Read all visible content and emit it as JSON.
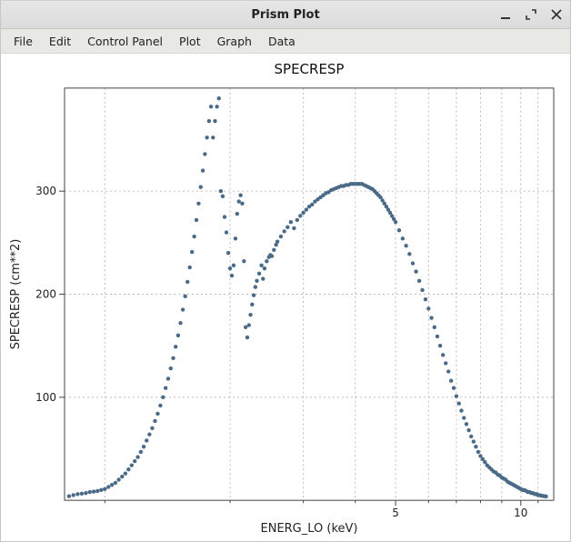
{
  "window": {
    "title": "Prism Plot"
  },
  "menu": {
    "items": [
      {
        "label": "File"
      },
      {
        "label": "Edit"
      },
      {
        "label": "Control Panel"
      },
      {
        "label": "Plot"
      },
      {
        "label": "Graph"
      },
      {
        "label": "Data"
      }
    ]
  },
  "chart_data": {
    "type": "scatter",
    "title": "SPECRESP",
    "xlabel": "ENERG_LO (keV)",
    "ylabel": "SPECRESP (cm**2)",
    "xscale": "log",
    "yscale": "linear",
    "xlim": [
      0.8,
      12
    ],
    "ylim": [
      0,
      400
    ],
    "xticks_major": [
      5,
      10
    ],
    "xticks_minor": [
      1,
      2,
      3,
      4,
      6,
      7,
      8,
      9,
      11
    ],
    "yticks_major": [
      100,
      200,
      300
    ],
    "color": "#4a6a88",
    "grid": true,
    "series": [
      {
        "name": "SPECRESP",
        "points": [
          [
            0.82,
            4
          ],
          [
            0.84,
            5
          ],
          [
            0.86,
            6
          ],
          [
            0.88,
            6.5
          ],
          [
            0.9,
            7
          ],
          [
            0.92,
            8
          ],
          [
            0.94,
            8.5
          ],
          [
            0.96,
            9
          ],
          [
            0.98,
            10
          ],
          [
            1.0,
            11
          ],
          [
            1.02,
            13
          ],
          [
            1.04,
            15
          ],
          [
            1.06,
            17
          ],
          [
            1.08,
            20
          ],
          [
            1.1,
            23
          ],
          [
            1.12,
            26
          ],
          [
            1.14,
            30
          ],
          [
            1.16,
            34
          ],
          [
            1.18,
            38
          ],
          [
            1.2,
            42
          ],
          [
            1.22,
            47
          ],
          [
            1.24,
            52
          ],
          [
            1.26,
            58
          ],
          [
            1.28,
            64
          ],
          [
            1.3,
            70
          ],
          [
            1.32,
            77
          ],
          [
            1.34,
            84
          ],
          [
            1.36,
            92
          ],
          [
            1.38,
            100
          ],
          [
            1.4,
            109
          ],
          [
            1.42,
            118
          ],
          [
            1.44,
            128
          ],
          [
            1.46,
            138
          ],
          [
            1.48,
            149
          ],
          [
            1.5,
            160
          ],
          [
            1.52,
            172
          ],
          [
            1.54,
            185
          ],
          [
            1.56,
            198
          ],
          [
            1.58,
            212
          ],
          [
            1.6,
            226
          ],
          [
            1.62,
            241
          ],
          [
            1.64,
            256
          ],
          [
            1.66,
            272
          ],
          [
            1.68,
            288
          ],
          [
            1.7,
            304
          ],
          [
            1.72,
            320
          ],
          [
            1.74,
            336
          ],
          [
            1.76,
            352
          ],
          [
            1.78,
            368
          ],
          [
            1.8,
            382
          ],
          [
            1.82,
            352
          ],
          [
            1.84,
            368
          ],
          [
            1.86,
            382
          ],
          [
            1.88,
            390
          ],
          [
            1.9,
            300
          ],
          [
            1.92,
            295
          ],
          [
            1.94,
            275
          ],
          [
            1.96,
            260
          ],
          [
            1.98,
            240
          ],
          [
            2.0,
            225
          ],
          [
            2.02,
            218
          ],
          [
            2.04,
            228
          ],
          [
            2.06,
            254
          ],
          [
            2.08,
            278
          ],
          [
            2.1,
            290
          ],
          [
            2.12,
            296
          ],
          [
            2.14,
            288
          ],
          [
            2.16,
            232
          ],
          [
            2.18,
            168
          ],
          [
            2.2,
            158
          ],
          [
            2.22,
            170
          ],
          [
            2.24,
            180
          ],
          [
            2.26,
            190
          ],
          [
            2.28,
            199
          ],
          [
            2.3,
            207
          ],
          [
            2.32,
            213
          ],
          [
            2.35,
            220
          ],
          [
            2.38,
            228
          ],
          [
            2.4,
            215
          ],
          [
            2.42,
            225
          ],
          [
            2.45,
            232
          ],
          [
            2.48,
            236
          ],
          [
            2.5,
            238
          ],
          [
            2.52,
            237
          ],
          [
            2.55,
            243
          ],
          [
            2.58,
            248
          ],
          [
            2.6,
            251
          ],
          [
            2.65,
            256
          ],
          [
            2.7,
            261
          ],
          [
            2.75,
            265
          ],
          [
            2.8,
            270
          ],
          [
            2.85,
            264
          ],
          [
            2.9,
            272
          ],
          [
            2.95,
            276
          ],
          [
            3.0,
            279
          ],
          [
            3.05,
            282
          ],
          [
            3.1,
            285
          ],
          [
            3.15,
            287
          ],
          [
            3.2,
            290
          ],
          [
            3.25,
            292
          ],
          [
            3.3,
            294
          ],
          [
            3.35,
            296
          ],
          [
            3.4,
            298
          ],
          [
            3.45,
            299
          ],
          [
            3.5,
            301
          ],
          [
            3.55,
            302
          ],
          [
            3.6,
            303
          ],
          [
            3.65,
            304
          ],
          [
            3.7,
            305
          ],
          [
            3.75,
            305
          ],
          [
            3.8,
            306
          ],
          [
            3.85,
            306
          ],
          [
            3.9,
            307
          ],
          [
            3.95,
            307
          ],
          [
            4.0,
            307
          ],
          [
            4.05,
            307
          ],
          [
            4.1,
            307
          ],
          [
            4.15,
            307
          ],
          [
            4.2,
            306
          ],
          [
            4.25,
            305
          ],
          [
            4.3,
            304
          ],
          [
            4.35,
            303
          ],
          [
            4.4,
            302
          ],
          [
            4.45,
            300
          ],
          [
            4.5,
            298
          ],
          [
            4.55,
            296
          ],
          [
            4.6,
            294
          ],
          [
            4.65,
            291
          ],
          [
            4.7,
            288
          ],
          [
            4.75,
            285
          ],
          [
            4.8,
            282
          ],
          [
            4.85,
            279
          ],
          [
            4.9,
            276
          ],
          [
            4.95,
            273
          ],
          [
            5.0,
            270
          ],
          [
            5.1,
            262
          ],
          [
            5.2,
            254
          ],
          [
            5.3,
            247
          ],
          [
            5.4,
            239
          ],
          [
            5.5,
            230
          ],
          [
            5.6,
            222
          ],
          [
            5.7,
            213
          ],
          [
            5.8,
            204
          ],
          [
            5.9,
            195
          ],
          [
            6.0,
            186
          ],
          [
            6.1,
            177
          ],
          [
            6.2,
            168
          ],
          [
            6.3,
            159
          ],
          [
            6.4,
            150
          ],
          [
            6.5,
            141
          ],
          [
            6.6,
            133
          ],
          [
            6.7,
            125
          ],
          [
            6.8,
            116
          ],
          [
            6.9,
            109
          ],
          [
            7.0,
            101
          ],
          [
            7.1,
            94
          ],
          [
            7.2,
            87
          ],
          [
            7.3,
            80
          ],
          [
            7.4,
            74
          ],
          [
            7.5,
            68
          ],
          [
            7.6,
            62
          ],
          [
            7.7,
            57
          ],
          [
            7.8,
            52
          ],
          [
            7.9,
            47
          ],
          [
            8.0,
            43
          ],
          [
            8.1,
            40
          ],
          [
            8.2,
            37
          ],
          [
            8.3,
            34
          ],
          [
            8.4,
            32
          ],
          [
            8.5,
            30
          ],
          [
            8.6,
            28
          ],
          [
            8.7,
            27
          ],
          [
            8.8,
            25
          ],
          [
            8.9,
            24
          ],
          [
            9.0,
            22
          ],
          [
            9.1,
            21
          ],
          [
            9.2,
            20
          ],
          [
            9.3,
            18
          ],
          [
            9.4,
            17
          ],
          [
            9.5,
            16
          ],
          [
            9.6,
            15
          ],
          [
            9.7,
            14
          ],
          [
            9.8,
            13
          ],
          [
            9.9,
            12
          ],
          [
            10.0,
            11
          ],
          [
            10.1,
            10
          ],
          [
            10.2,
            10
          ],
          [
            10.3,
            9
          ],
          [
            10.4,
            8
          ],
          [
            10.5,
            8
          ],
          [
            10.6,
            7
          ],
          [
            10.7,
            7
          ],
          [
            10.8,
            6
          ],
          [
            10.9,
            6
          ],
          [
            11.0,
            5
          ],
          [
            11.1,
            5
          ],
          [
            11.2,
            4.5
          ],
          [
            11.3,
            4.3
          ],
          [
            11.4,
            4
          ],
          [
            11.5,
            3.8
          ]
        ]
      }
    ]
  }
}
